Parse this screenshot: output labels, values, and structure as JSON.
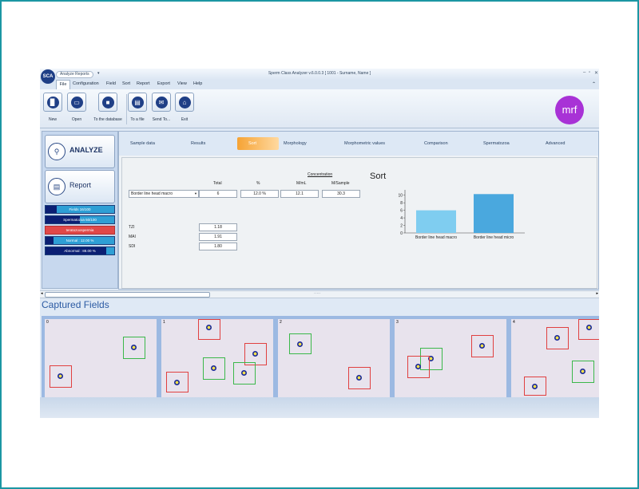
{
  "window": {
    "title": "Sperm Class Analyzer v.6.0.0.3  [ 1001 - Surname, Name ]",
    "logo": "SCA",
    "top_tab": "Analyze Reports"
  },
  "menu": {
    "file": "File",
    "items": [
      "Configuration",
      "Field",
      "Sort",
      "Report",
      "Export",
      "View",
      "Help"
    ]
  },
  "ribbon": {
    "buttons": [
      {
        "label": "New",
        "icon": "new-file-icon",
        "glyph": "▉"
      },
      {
        "label": "Open",
        "icon": "open-folder-icon",
        "glyph": "▭"
      },
      {
        "label": "To the database",
        "icon": "save-disk-icon",
        "glyph": "■"
      },
      {
        "label": "To a file",
        "icon": "save-file-icon",
        "glyph": "▤"
      },
      {
        "label": "Send To...",
        "icon": "send-mail-icon",
        "glyph": "✉"
      },
      {
        "label": "Exit",
        "icon": "home-icon",
        "glyph": "⌂"
      }
    ],
    "brand": "mrf",
    "brand_color": "#a832d6"
  },
  "left": {
    "analyze": "ANALYZE",
    "report": "Report",
    "bars": [
      {
        "label": "Fields 16/100",
        "fraction": 0.16
      },
      {
        "label": "Spermatozoa 50/100",
        "fraction": 0.5
      },
      {
        "label": "teratozoospermia",
        "fraction": 1.0,
        "status": "red"
      },
      {
        "label": "Normal : 12.00 %",
        "fraction": 0.12
      },
      {
        "label": "Abnormal : 88.00 %",
        "fraction": 0.88
      }
    ]
  },
  "tabs": [
    "Sample data",
    "Results",
    "Sort",
    "Morphology",
    "Morphometric values",
    "Comparison",
    "Spermatozoa",
    "Advanced"
  ],
  "active_tab": "Sort",
  "sort": {
    "concentration_header": "Concentration",
    "columns": [
      "Total",
      "%",
      "M/mL",
      "M/Sample"
    ],
    "selected": "Border line head macro",
    "values": [
      "6",
      "12.0 %",
      "12.1",
      "30.3"
    ],
    "indices": [
      {
        "label": "TZI",
        "value": "1.18"
      },
      {
        "label": "MAI",
        "value": "1.91"
      },
      {
        "label": "SDI",
        "value": "1.80"
      }
    ],
    "chart_title": "Sort"
  },
  "chart_data": {
    "type": "bar",
    "title": "Sort",
    "categories": [
      "Border line head macro",
      "Border line head micro"
    ],
    "values": [
      6,
      10.3
    ],
    "ylim": [
      0,
      11
    ],
    "yticks": [
      "10",
      "8",
      "6",
      "4",
      "2",
      "0"
    ],
    "colors": [
      "#7fcdf0",
      "#4aa8de"
    ]
  },
  "captured": {
    "title": "Captured Fields",
    "fields": [
      "0",
      "1",
      "2",
      "3",
      "4"
    ],
    "grip": "·····"
  }
}
